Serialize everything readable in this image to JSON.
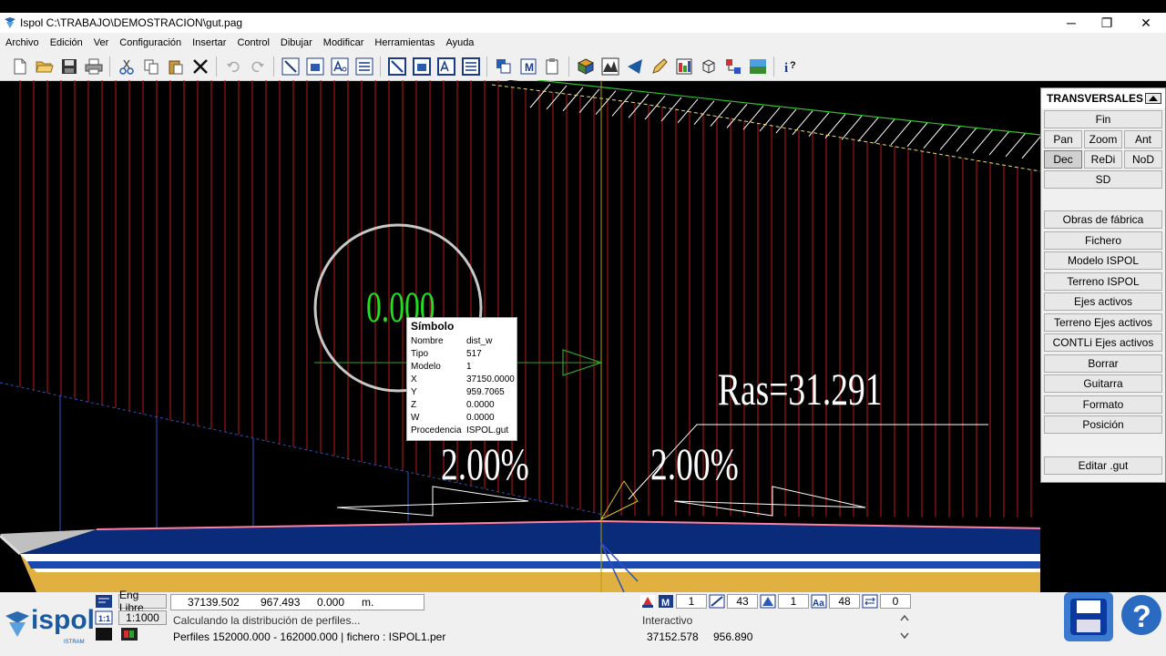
{
  "window": {
    "title": "Ispol  C:\\TRABAJO\\DEMOSTRACION\\gut.pag",
    "minimize": "─",
    "restore": "❐",
    "close": "✕"
  },
  "menu": [
    "Archivo",
    "Edición",
    "Ver",
    "Configuración",
    "Insertar",
    "Control",
    "Dibujar",
    "Modificar",
    "Herramientas",
    "Ayuda"
  ],
  "panel": {
    "title": "TRANSVERSALES",
    "fin": "Fin",
    "pan": "Pan",
    "zoom": "Zoom",
    "ant": "Ant",
    "dec": "Dec",
    "redi": "ReDi",
    "nod": "NoD",
    "sd": "SD",
    "items": [
      "Obras de fábrica",
      "Fichero",
      "Modelo  ISPOL",
      "Terreno ISPOL",
      "Ejes activos",
      "Terreno Ejes activos",
      "CONTLi Ejes activos",
      "Borrar",
      "Guitarra",
      "Formato",
      "Posición"
    ],
    "editar": "Editar .gut"
  },
  "drawing": {
    "zero_label": "0.000",
    "ras_label": "Ras=31.291",
    "slope_left": "2.00%",
    "slope_right": "2.00%"
  },
  "tooltip": {
    "title": "Símbolo",
    "rows": [
      {
        "k": "Nombre",
        "v": "dist_w"
      },
      {
        "k": "Tipo",
        "v": "517"
      },
      {
        "k": "Modelo",
        "v": "1"
      },
      {
        "k": "X",
        "v": "37150.0000"
      },
      {
        "k": "Y",
        "v": "959.7065"
      },
      {
        "k": "Z",
        "v": "0.0000"
      },
      {
        "k": "W",
        "v": "0.0000"
      },
      {
        "k": "Procedencia",
        "v": "ISPOL.gut"
      }
    ]
  },
  "status": {
    "mode_button": "Eng Libre",
    "scale": "1:1000",
    "coord_x": "37139.502",
    "coord_y": "967.493",
    "coord_z": "0.000",
    "unit": "m.",
    "message": "Calculando la distribución de perfiles...",
    "profiles": "Perfiles 152000.000 - 162000.000 | fichero : ISPOL1.per",
    "mode": "Interactivo",
    "cursor_x": "37152.578",
    "cursor_y": "956.890",
    "spin1": "1",
    "spin2": "43",
    "spin3": "1",
    "spin4": "48",
    "spin5": "0",
    "logo": "ispol",
    "logo_sub": "ISTRAM"
  }
}
